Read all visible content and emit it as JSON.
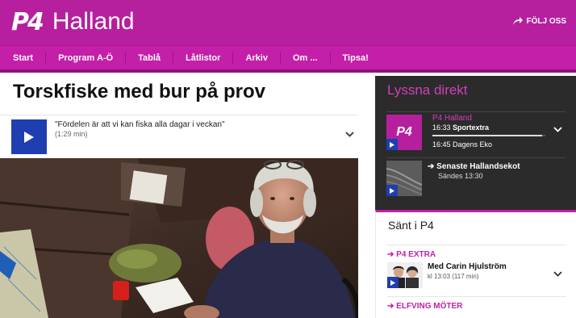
{
  "header": {
    "logo_mark": "P4",
    "station_name": "Halland",
    "follow_label": "FÖLJ OSS"
  },
  "nav": {
    "items": [
      "Start",
      "Program A-Ö",
      "Tablå",
      "Låtlistor",
      "Arkiv",
      "Om ...",
      "Tipsa!"
    ]
  },
  "article": {
    "title": "Torskfiske med bur på prov",
    "audio": {
      "title": "\"Fördelen är att vi kan fiska alla dagar i veckan\"",
      "duration": "(1:29 min)"
    }
  },
  "sidebar": {
    "live": {
      "heading": "Lyssna direkt",
      "channel": {
        "name": "P4 Halland",
        "now_time": "16:33",
        "now_program": "Sportextra",
        "progress": 0.97,
        "next": "16:45 Dagens Eko"
      },
      "podcast": {
        "title": "Senaste Hallandsekot",
        "aired": "Sändes 13:30"
      }
    },
    "sent": {
      "heading": "Sänt i P4",
      "sections": [
        {
          "label": "P4 EXTRA",
          "episode_title": "Med Carin Hjulström",
          "episode_time": "kl 13:03",
          "episode_duration": "(117 min)"
        },
        {
          "label": "ELFVING MÖTER"
        }
      ]
    }
  },
  "colors": {
    "brand": "#b61f9e",
    "nav": "#c41fa8",
    "play": "#1f3eb0",
    "live_bg": "#2b2b2b"
  }
}
